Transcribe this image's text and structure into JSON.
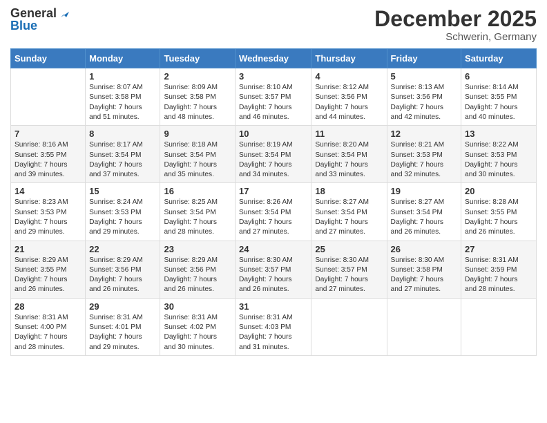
{
  "logo": {
    "general": "General",
    "blue": "Blue"
  },
  "header": {
    "month": "December 2025",
    "location": "Schwerin, Germany"
  },
  "weekdays": [
    "Sunday",
    "Monday",
    "Tuesday",
    "Wednesday",
    "Thursday",
    "Friday",
    "Saturday"
  ],
  "weeks": [
    [
      {
        "day": "",
        "info": ""
      },
      {
        "day": "1",
        "info": "Sunrise: 8:07 AM\nSunset: 3:58 PM\nDaylight: 7 hours\nand 51 minutes."
      },
      {
        "day": "2",
        "info": "Sunrise: 8:09 AM\nSunset: 3:58 PM\nDaylight: 7 hours\nand 48 minutes."
      },
      {
        "day": "3",
        "info": "Sunrise: 8:10 AM\nSunset: 3:57 PM\nDaylight: 7 hours\nand 46 minutes."
      },
      {
        "day": "4",
        "info": "Sunrise: 8:12 AM\nSunset: 3:56 PM\nDaylight: 7 hours\nand 44 minutes."
      },
      {
        "day": "5",
        "info": "Sunrise: 8:13 AM\nSunset: 3:56 PM\nDaylight: 7 hours\nand 42 minutes."
      },
      {
        "day": "6",
        "info": "Sunrise: 8:14 AM\nSunset: 3:55 PM\nDaylight: 7 hours\nand 40 minutes."
      }
    ],
    [
      {
        "day": "7",
        "info": "Sunrise: 8:16 AM\nSunset: 3:55 PM\nDaylight: 7 hours\nand 39 minutes."
      },
      {
        "day": "8",
        "info": "Sunrise: 8:17 AM\nSunset: 3:54 PM\nDaylight: 7 hours\nand 37 minutes."
      },
      {
        "day": "9",
        "info": "Sunrise: 8:18 AM\nSunset: 3:54 PM\nDaylight: 7 hours\nand 35 minutes."
      },
      {
        "day": "10",
        "info": "Sunrise: 8:19 AM\nSunset: 3:54 PM\nDaylight: 7 hours\nand 34 minutes."
      },
      {
        "day": "11",
        "info": "Sunrise: 8:20 AM\nSunset: 3:54 PM\nDaylight: 7 hours\nand 33 minutes."
      },
      {
        "day": "12",
        "info": "Sunrise: 8:21 AM\nSunset: 3:53 PM\nDaylight: 7 hours\nand 32 minutes."
      },
      {
        "day": "13",
        "info": "Sunrise: 8:22 AM\nSunset: 3:53 PM\nDaylight: 7 hours\nand 30 minutes."
      }
    ],
    [
      {
        "day": "14",
        "info": "Sunrise: 8:23 AM\nSunset: 3:53 PM\nDaylight: 7 hours\nand 29 minutes."
      },
      {
        "day": "15",
        "info": "Sunrise: 8:24 AM\nSunset: 3:53 PM\nDaylight: 7 hours\nand 29 minutes."
      },
      {
        "day": "16",
        "info": "Sunrise: 8:25 AM\nSunset: 3:54 PM\nDaylight: 7 hours\nand 28 minutes."
      },
      {
        "day": "17",
        "info": "Sunrise: 8:26 AM\nSunset: 3:54 PM\nDaylight: 7 hours\nand 27 minutes."
      },
      {
        "day": "18",
        "info": "Sunrise: 8:27 AM\nSunset: 3:54 PM\nDaylight: 7 hours\nand 27 minutes."
      },
      {
        "day": "19",
        "info": "Sunrise: 8:27 AM\nSunset: 3:54 PM\nDaylight: 7 hours\nand 26 minutes."
      },
      {
        "day": "20",
        "info": "Sunrise: 8:28 AM\nSunset: 3:55 PM\nDaylight: 7 hours\nand 26 minutes."
      }
    ],
    [
      {
        "day": "21",
        "info": "Sunrise: 8:29 AM\nSunset: 3:55 PM\nDaylight: 7 hours\nand 26 minutes."
      },
      {
        "day": "22",
        "info": "Sunrise: 8:29 AM\nSunset: 3:56 PM\nDaylight: 7 hours\nand 26 minutes."
      },
      {
        "day": "23",
        "info": "Sunrise: 8:29 AM\nSunset: 3:56 PM\nDaylight: 7 hours\nand 26 minutes."
      },
      {
        "day": "24",
        "info": "Sunrise: 8:30 AM\nSunset: 3:57 PM\nDaylight: 7 hours\nand 26 minutes."
      },
      {
        "day": "25",
        "info": "Sunrise: 8:30 AM\nSunset: 3:57 PM\nDaylight: 7 hours\nand 27 minutes."
      },
      {
        "day": "26",
        "info": "Sunrise: 8:30 AM\nSunset: 3:58 PM\nDaylight: 7 hours\nand 27 minutes."
      },
      {
        "day": "27",
        "info": "Sunrise: 8:31 AM\nSunset: 3:59 PM\nDaylight: 7 hours\nand 28 minutes."
      }
    ],
    [
      {
        "day": "28",
        "info": "Sunrise: 8:31 AM\nSunset: 4:00 PM\nDaylight: 7 hours\nand 28 minutes."
      },
      {
        "day": "29",
        "info": "Sunrise: 8:31 AM\nSunset: 4:01 PM\nDaylight: 7 hours\nand 29 minutes."
      },
      {
        "day": "30",
        "info": "Sunrise: 8:31 AM\nSunset: 4:02 PM\nDaylight: 7 hours\nand 30 minutes."
      },
      {
        "day": "31",
        "info": "Sunrise: 8:31 AM\nSunset: 4:03 PM\nDaylight: 7 hours\nand 31 minutes."
      },
      {
        "day": "",
        "info": ""
      },
      {
        "day": "",
        "info": ""
      },
      {
        "day": "",
        "info": ""
      }
    ]
  ]
}
